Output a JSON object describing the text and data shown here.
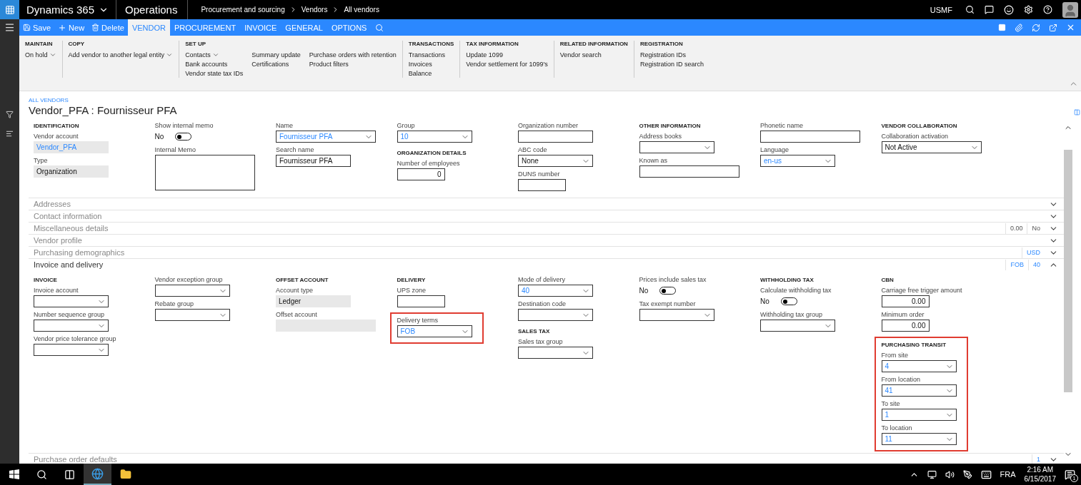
{
  "top_bar": {
    "product": "Dynamics 365",
    "app": "Operations",
    "breadcrumb": [
      "Procurement and sourcing",
      "Vendors",
      "All vendors"
    ],
    "company": "USMF"
  },
  "actions": [
    "Save",
    "New",
    "Delete"
  ],
  "tabs": [
    {
      "label": "VENDOR",
      "selected": true
    },
    {
      "label": "PROCUREMENT",
      "selected": false
    },
    {
      "label": "INVOICE",
      "selected": false
    },
    {
      "label": "GENERAL",
      "selected": false
    },
    {
      "label": "OPTIONS",
      "selected": false
    }
  ],
  "ribbon": [
    {
      "title": "MAINTAIN",
      "columns": [
        [
          {
            "label": "On hold",
            "dropdown": true
          }
        ]
      ]
    },
    {
      "title": "COPY",
      "columns": [
        [
          {
            "label": "Add vendor to another legal entity",
            "dropdown": true
          }
        ]
      ]
    },
    {
      "title": "SET UP",
      "columns": [
        [
          {
            "label": "Contacts",
            "dropdown": true
          },
          {
            "label": "Bank accounts",
            "dropdown": false
          },
          {
            "label": "Vendor state tax IDs",
            "dropdown": false
          }
        ],
        [
          {
            "label": "Summary update",
            "dropdown": false
          },
          {
            "label": "Certifications",
            "dropdown": false
          }
        ],
        [
          {
            "label": "Purchase orders with retention",
            "dropdown": false
          },
          {
            "label": "Product filters",
            "dropdown": false
          }
        ]
      ]
    },
    {
      "title": "TRANSACTIONS",
      "columns": [
        [
          {
            "label": "Transactions",
            "dropdown": false
          },
          {
            "label": "Invoices",
            "dropdown": false
          },
          {
            "label": "Balance",
            "dropdown": false
          }
        ]
      ]
    },
    {
      "title": "TAX INFORMATION",
      "columns": [
        [
          {
            "label": "Update 1099",
            "dropdown": false
          },
          {
            "label": "Vendor settlement for 1099's",
            "dropdown": false
          }
        ]
      ]
    },
    {
      "title": "RELATED INFORMATION",
      "columns": [
        [
          {
            "label": "Vendor search",
            "dropdown": false
          }
        ]
      ]
    },
    {
      "title": "REGISTRATION",
      "columns": [
        [
          {
            "label": "Registration IDs",
            "dropdown": false
          },
          {
            "label": "Registration ID search",
            "dropdown": false
          }
        ]
      ]
    }
  ],
  "page": {
    "breadcrumb": "ALL VENDORS",
    "title": "Vendor_PFA : Fournisseur PFA"
  },
  "header": {
    "columns": [
      [
        {
          "heading": "IDENTIFICATION",
          "highlighted": false,
          "fields": [
            {
              "kind": "readonly",
              "label": "Vendor account",
              "value": "Vendor_PFA",
              "link": true
            },
            {
              "kind": "readonly",
              "label": "Type",
              "value": "Organization",
              "link": false
            }
          ]
        }
      ],
      [
        {
          "highlighted": false,
          "fields": [
            {
              "kind": "toggle",
              "label": "Show internal memo",
              "value": "No",
              "on": false
            },
            {
              "kind": "memo",
              "label": "Internal Memo"
            }
          ]
        }
      ],
      [
        {
          "highlighted": false,
          "fields": [
            {
              "kind": "wide-select",
              "label": "Name",
              "value": "Fournisseur PFA",
              "link": true
            },
            {
              "kind": "input",
              "label": "Search name",
              "value": "Fournisseur PFA",
              "link": false
            }
          ]
        }
      ],
      [
        {
          "highlighted": false,
          "fields": [
            {
              "kind": "select",
              "label": "Group",
              "value": "10",
              "link": true
            }
          ]
        },
        {
          "heading": "ORGANIZATION DETAILS",
          "highlighted": false,
          "fields": [
            {
              "kind": "number",
              "label": "Number of employees",
              "value": "0",
              "link": false
            }
          ]
        }
      ],
      [
        {
          "highlighted": false,
          "fields": [
            {
              "kind": "input",
              "label": "Organization number"
            },
            {
              "kind": "select",
              "label": "ABC code",
              "value": "None",
              "link": false
            },
            {
              "kind": "short-input",
              "label": "DUNS number"
            }
          ]
        }
      ],
      [
        {
          "heading": "OTHER INFORMATION",
          "highlighted": false,
          "fields": [
            {
              "kind": "select",
              "label": "Address books"
            },
            {
              "kind": "wide-input",
              "label": "Known as"
            }
          ]
        }
      ],
      [
        {
          "highlighted": false,
          "fields": [
            {
              "kind": "wide-input",
              "label": "Phonetic name"
            },
            {
              "kind": "select",
              "label": "Language",
              "value": "en-us",
              "link": true
            }
          ]
        }
      ],
      [
        {
          "heading": "VENDOR COLLABORATION",
          "highlighted": false,
          "fields": [
            {
              "kind": "wide-select",
              "label": "Collaboration activation",
              "value": "Not Active",
              "link": false
            }
          ]
        }
      ]
    ]
  },
  "fasttabs": [
    {
      "label": "Addresses",
      "expanded": false
    },
    {
      "label": "Contact information",
      "expanded": false
    },
    {
      "label": "Miscellaneous details",
      "expanded": false,
      "summaries": [
        "0.00",
        "No"
      ]
    },
    {
      "label": "Vendor profile",
      "expanded": false
    },
    {
      "label": "Purchasing demographics",
      "expanded": false,
      "summaries": [
        "USD"
      ]
    },
    {
      "label": "Invoice and delivery",
      "expanded": true,
      "summaries": [
        "FOB",
        "40"
      ],
      "columns": [
        [
          {
            "heading": "INVOICE",
            "highlighted": false,
            "fields": [
              {
                "kind": "select",
                "label": "Invoice account"
              },
              {
                "kind": "select",
                "label": "Number sequence group"
              },
              {
                "kind": "select",
                "label": "Vendor price tolerance group"
              }
            ]
          }
        ],
        [
          {
            "highlighted": false,
            "fields": [
              {
                "kind": "select",
                "label": "Vendor exception group"
              },
              {
                "kind": "select",
                "label": "Rebate group"
              }
            ]
          }
        ],
        [
          {
            "heading": "OFFSET ACCOUNT",
            "highlighted": false,
            "fields": [
              {
                "kind": "readonly",
                "label": "Account type",
                "value": "Ledger",
                "link": false
              },
              {
                "kind": "wide-readonly",
                "label": "Offset account"
              }
            ]
          }
        ],
        [
          {
            "heading": "DELIVERY",
            "highlighted": false,
            "fields": [
              {
                "kind": "short-input",
                "label": "UPS zone"
              }
            ]
          },
          {
            "highlighted": true,
            "fields": [
              {
                "kind": "select",
                "label": "Delivery terms",
                "value": "FOB",
                "link": true
              }
            ]
          }
        ],
        [
          {
            "highlighted": false,
            "fields": [
              {
                "kind": "select",
                "label": "Mode of delivery",
                "value": "40",
                "link": true
              },
              {
                "kind": "select",
                "label": "Destination code"
              }
            ]
          },
          {
            "heading": "SALES TAX",
            "highlighted": false,
            "fields": [
              {
                "kind": "select",
                "label": "Sales tax group"
              }
            ]
          }
        ],
        [
          {
            "highlighted": false,
            "fields": [
              {
                "kind": "toggle",
                "label": "Prices include sales tax",
                "value": "No",
                "on": false
              },
              {
                "kind": "select",
                "label": "Tax exempt number"
              }
            ]
          }
        ],
        [
          {
            "heading": "WITHHOLDING TAX",
            "highlighted": false,
            "fields": [
              {
                "kind": "toggle",
                "label": "Calculate withholding tax",
                "value": "No",
                "on": false
              },
              {
                "kind": "select",
                "label": "Withholding tax group"
              }
            ]
          }
        ],
        [
          {
            "heading": "CBN",
            "highlighted": false,
            "fields": [
              {
                "kind": "number",
                "label": "Carriage free trigger amount",
                "value": "0.00",
                "link": false
              },
              {
                "kind": "number",
                "label": "Minimum order",
                "value": "0.00",
                "link": false
              }
            ]
          },
          {
            "heading": "PURCHASING TRANSIT",
            "highlighted": true,
            "fields": [
              {
                "kind": "select",
                "label": "From site",
                "value": "4",
                "link": true
              },
              {
                "kind": "select",
                "label": "From location",
                "value": "41",
                "link": true
              },
              {
                "kind": "select",
                "label": "To site",
                "value": "1",
                "link": true
              },
              {
                "kind": "select",
                "label": "To location",
                "value": "11",
                "link": true
              }
            ]
          }
        ]
      ]
    },
    {
      "label": "Purchase order defaults",
      "expanded": false,
      "summaries": [
        "1"
      ]
    }
  ],
  "taskbar": {
    "language": "FRA",
    "time": "2:16 AM",
    "date": "6/15/2017",
    "notifications": "1"
  }
}
